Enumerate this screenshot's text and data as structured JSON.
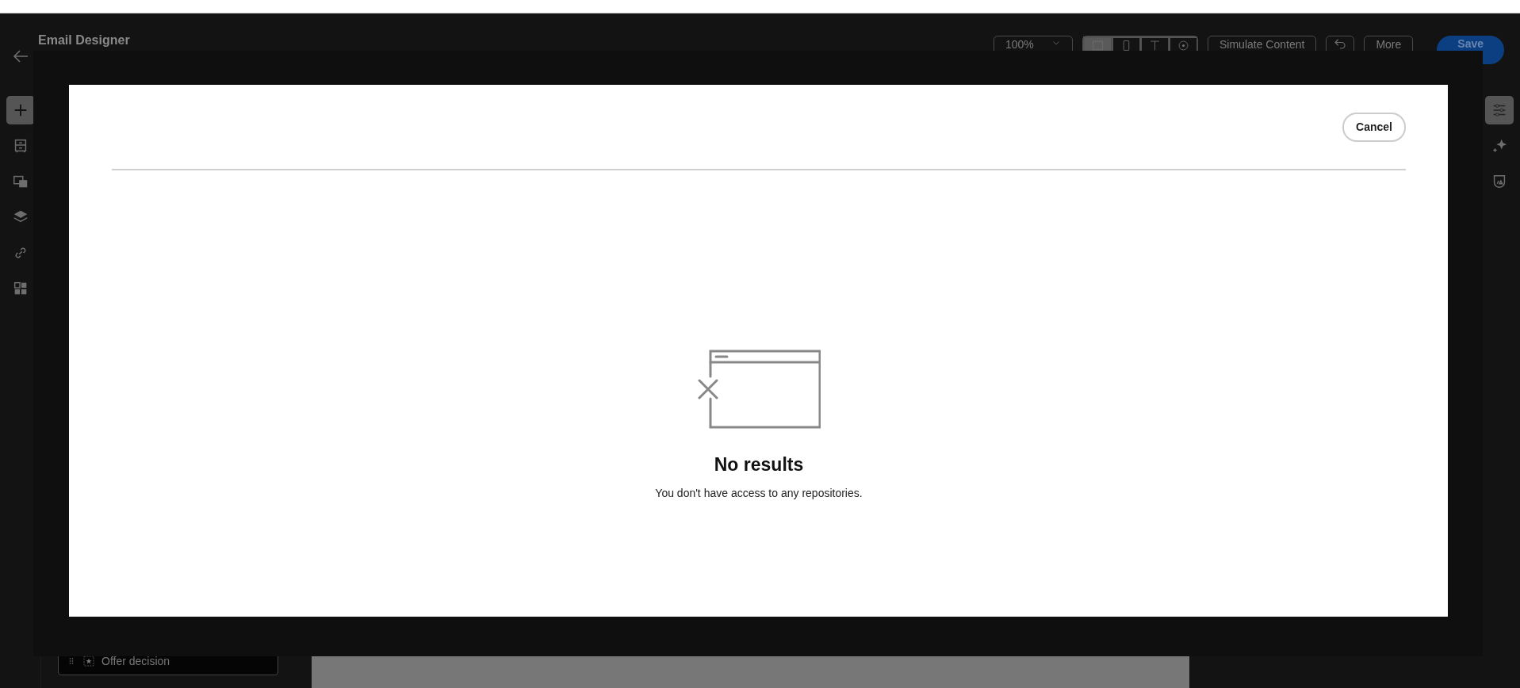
{
  "header": {
    "title": "Email Designer",
    "zoom": "100%",
    "views": [
      {
        "selected": true
      },
      {
        "selected": false
      },
      {
        "selected": false
      },
      {
        "selected": false
      }
    ],
    "buttons": [
      "Simulate Content",
      "More"
    ],
    "save": "Save"
  },
  "left_toolbar": [
    {
      "selected": true
    },
    {
      "selected": false
    },
    {
      "selected": false
    },
    {
      "selected": false
    },
    {
      "selected": false
    },
    {
      "selected": false
    }
  ],
  "right_toolbar": [
    {
      "selected": true
    },
    {
      "selected": false
    },
    {
      "selected": false
    }
  ],
  "fragment": {
    "label": "Offer decision"
  },
  "dialog": {
    "cancel": "Cancel",
    "empty_state": {
      "title": "No results",
      "message": "You don't have access to any repositories."
    }
  }
}
